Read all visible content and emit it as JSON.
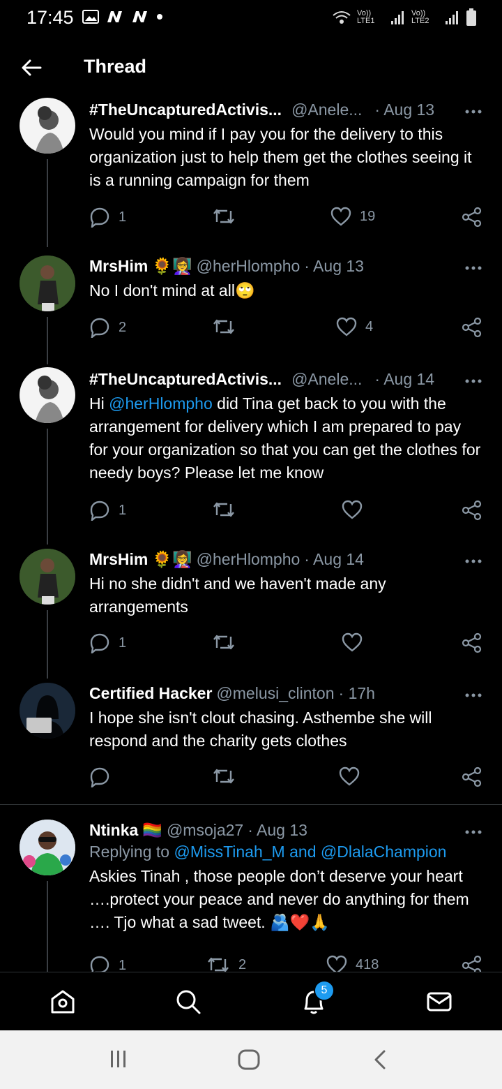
{
  "status_bar": {
    "time": "17:45",
    "sim1": "Vo)) LTE1",
    "sim2": "Vo)) LTE2"
  },
  "header": {
    "title": "Thread"
  },
  "tweets": [
    {
      "name": "#TheUncapturedActivis...",
      "handle": "@Anele...",
      "date": "· Aug 13",
      "text": "Would you mind if I pay you for the delivery to this organization just to help them get the clothes seeing it is a running campaign for them",
      "replies": "1",
      "retweets": "",
      "likes": "19"
    },
    {
      "name": "MrsHim",
      "name_emoji": "🌻👩‍🏫",
      "handle": "@herHlompho",
      "date": "· Aug 13",
      "text": "No I don't mind at all",
      "text_emoji": "🙄",
      "replies": "2",
      "retweets": "",
      "likes": "4"
    },
    {
      "name": "#TheUncapturedActivis...",
      "handle": "@Anele...",
      "date": "· Aug 14",
      "text_prefix": "Hi ",
      "text_mention": "@herHlompho",
      "text": " did Tina get back to you with the arrangement for delivery which I am prepared to pay for your organization so that you can get the clothes for needy boys? Please let me know",
      "replies": "1",
      "retweets": "",
      "likes": ""
    },
    {
      "name": "MrsHim",
      "name_emoji": "🌻👩‍🏫",
      "handle": "@herHlompho",
      "date": "· Aug 14",
      "text": "Hi no she didn't and we haven't made any arrangements",
      "replies": "1",
      "retweets": "",
      "likes": ""
    },
    {
      "name": "Certified Hacker",
      "handle": "@melusi_clinton",
      "date": "· 17h",
      "text": "I hope she isn't clout chasing. Asthembe she will respond and the charity gets clothes",
      "replies": "",
      "retweets": "",
      "likes": ""
    },
    {
      "name": "Ntinka",
      "name_emoji": "🏳️‍🌈",
      "handle": "@msoja27",
      "date": "· Aug 13",
      "reply_prefix": "Replying to ",
      "reply_mention": "@MissTinah_M and @DlalaChampion",
      "text": "Askies Tinah , those people don’t deserve your heart ….protect your peace and never do anything for them …. Tjo what a sad tweet.",
      "text_emoji": "🫂❤️🙏",
      "replies": "1",
      "retweets": "2",
      "likes": "418"
    }
  ],
  "bottom_nav": {
    "notification_count": "5"
  },
  "icons": [
    "back-arrow-icon",
    "more-icon",
    "reply-icon",
    "retweet-icon",
    "like-icon",
    "share-icon",
    "home-icon",
    "search-icon",
    "notifications-icon",
    "messages-icon"
  ],
  "colors": {
    "accent": "#1d9bf0",
    "secondary_text": "#8b98a5",
    "background": "#000000"
  }
}
